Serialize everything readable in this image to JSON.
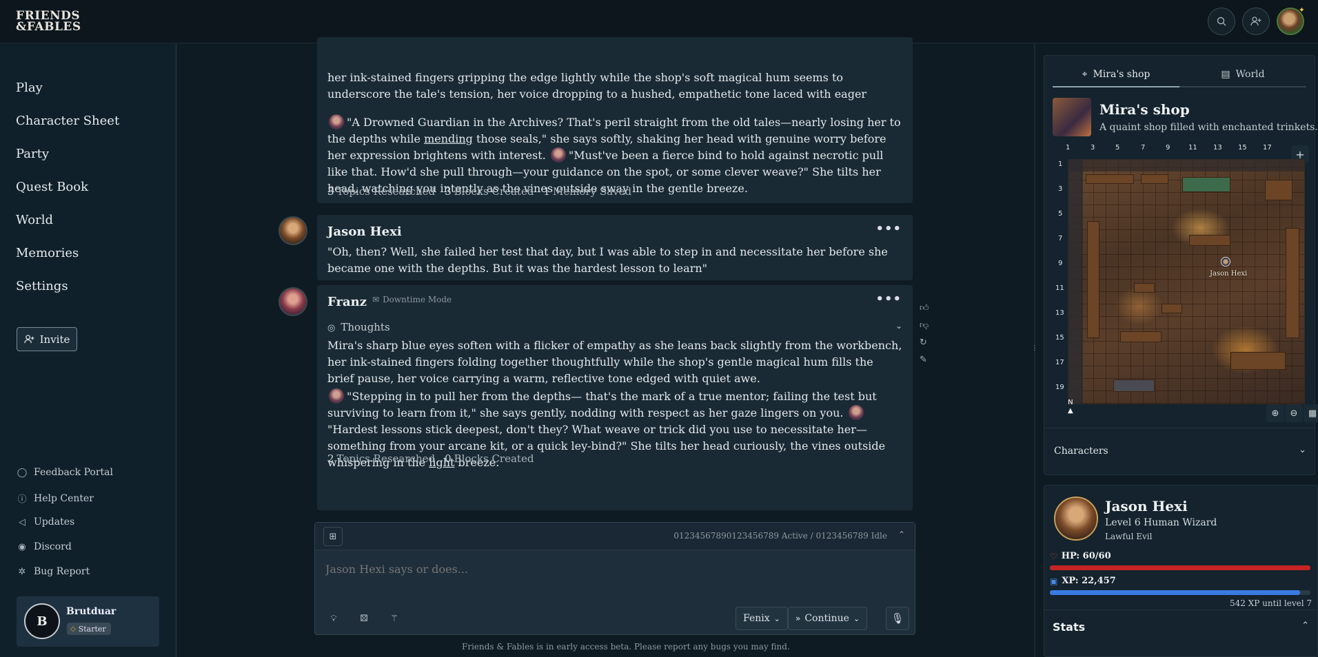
{
  "brand": {
    "line1": "FRIENDS",
    "line2": "&FABLES"
  },
  "topbar": {
    "search_icon": "search-icon",
    "add_user_icon": "add-user-icon"
  },
  "sidebar": {
    "nav": [
      "Play",
      "Character Sheet",
      "Party",
      "Quest Book",
      "World",
      "Memories",
      "Settings"
    ],
    "invite_label": "Invite",
    "links": [
      {
        "label": "Feedback Portal",
        "icon": "chat-bubble-icon"
      },
      {
        "label": "Help Center",
        "icon": "help-circle-icon"
      },
      {
        "label": "Updates",
        "icon": "megaphone-icon"
      },
      {
        "label": "Discord",
        "icon": "discord-icon"
      },
      {
        "label": "Bug Report",
        "icon": "bug-icon"
      }
    ],
    "user": {
      "initial": "B",
      "name": "Brutduar",
      "tier": "Starter"
    }
  },
  "chat": {
    "msg1": {
      "partial_top": "her ink-stained fingers gripping the edge lightly while the shop's soft magical hum seems to underscore the tale's tension, her voice dropping to a hushed, empathetic tone laced with eager curiosity.",
      "q1": "\"A Drowned Guardian in the Archives? That's peril straight from the old tales—nearly losing her to the depths while ",
      "q1_u": "mending",
      "q1_end": " those seals,\"",
      "n1": " she says softly, shaking her head with genuine worry before her expression brightens with interest. ",
      "q2": "\"Must've been a fierce bind to hold against necrotic pull like that. How'd she pull through—your guidance on the spot, or some clever weave?\"",
      "n2": " She tilts her head, watching you intently as the vines outside sway in the gentle breeze.",
      "stats": [
        {
          "n": "3",
          "label": "Topics Researched"
        },
        {
          "n": "3",
          "label": "Blocks Created"
        },
        {
          "n": "1",
          "label": "Memory Saved"
        }
      ]
    },
    "msg2": {
      "speaker": "Jason Hexi",
      "text": "\"Oh, then? Well, she failed her test that day, but I was able to step in and necessitate her before she became one with the depths. But it was the hardest lesson to learn\""
    },
    "msg3": {
      "speaker": "Franz",
      "mode": "Downtime Mode",
      "thoughts": "Thoughts",
      "p1": "Mira's sharp blue eyes soften with a flicker of empathy as she leans back slightly from the workbench, her ink-stained fingers folding together thoughtfully while the shop's gentle magical hum fills the brief pause, her voice carrying a warm, reflective tone edged with quiet awe.",
      "q1": "\"Stepping in to pull her from the depths— that's the mark of a true mentor; failing the test but surviving to learn from it,\"",
      "n1": " she says gently, nodding with respect as her gaze lingers on you. ",
      "q2": "\"Hardest lessons stick deepest, don't they? What weave or trick did you use to necessitate her—something from your arcane kit, or a quick ley-bind?\"",
      "n2a": " She tilts her head curiously, the vines outside whispering in the ",
      "n2_u": "light",
      "n2b": " breeze.",
      "stats": [
        {
          "n": "2",
          "label": "Topics Researched"
        },
        {
          "n": "0",
          "label": "Blocks Created"
        }
      ]
    },
    "composer": {
      "status": "0123456789012345678​9 Active / 0123456789 Idle",
      "placeholder": "Jason Hexi says or does...",
      "model": "Fenix",
      "continue": "Continue"
    },
    "beta_note": "Friends & Fables is in early access beta. Please report any bugs you may find."
  },
  "map": {
    "tab_location": "Mira's shop",
    "tab_world": "World",
    "title": "Mira's shop",
    "desc": "A quaint shop filled with enchanted trinkets...",
    "x_ticks": [
      "1",
      "3",
      "5",
      "7",
      "9",
      "11",
      "13",
      "15",
      "17"
    ],
    "y_ticks": [
      "1",
      "3",
      "5",
      "7",
      "9",
      "11",
      "13",
      "15",
      "17",
      "19"
    ],
    "token_label": "Jason Hexi",
    "compass": "N",
    "characters_label": "Characters"
  },
  "character": {
    "name": "Jason Hexi",
    "class": "Level 6 Human Wizard",
    "alignment": "Lawful Evil",
    "hp_label": "HP: 60/60",
    "hp_fraction": 1.0,
    "hp_color": "#c42424",
    "xp_label": "XP: 22,457",
    "xp_fraction": 0.96,
    "xp_color": "#3a7be0",
    "xp_note": "542 XP until level 7",
    "stats_label": "Stats"
  }
}
